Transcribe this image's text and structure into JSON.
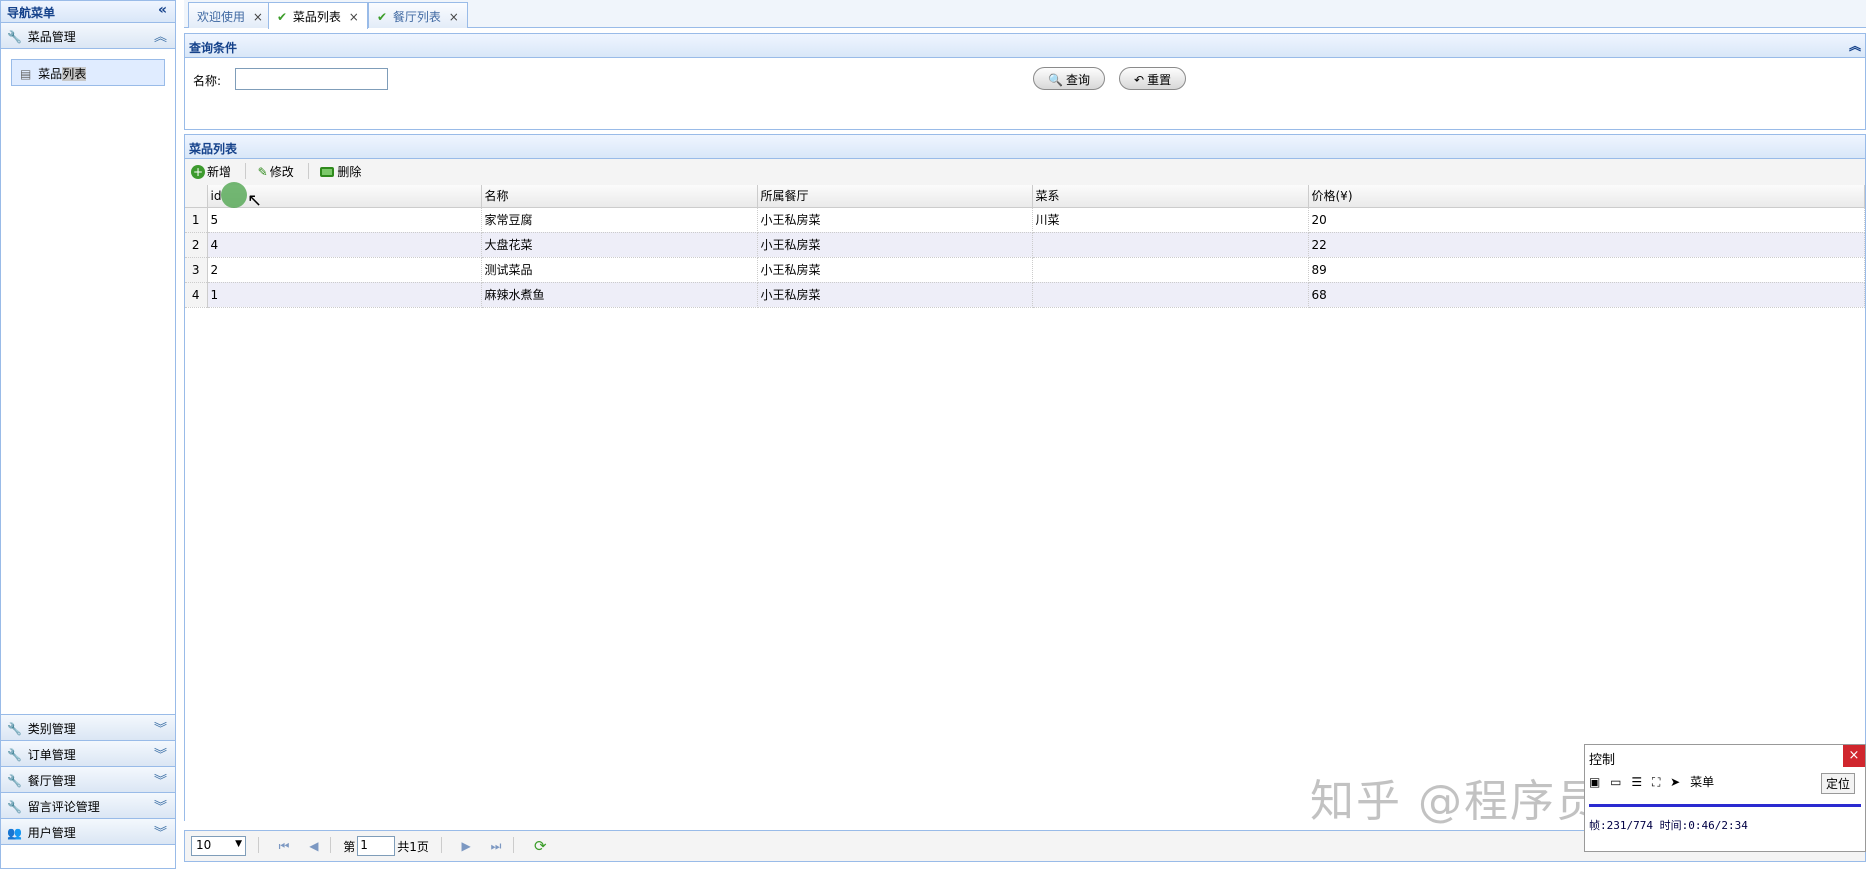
{
  "nav": {
    "title": "导航菜单",
    "sections": [
      {
        "label": "菜品管理",
        "items": [
          {
            "label_prefix": "菜品",
            "label_highlight": "列表"
          }
        ]
      }
    ],
    "collapsed_sections": [
      "类别管理",
      "订单管理",
      "餐厅管理",
      "留言评论管理",
      "用户管理"
    ]
  },
  "tabs": [
    {
      "label": "欢迎使用"
    },
    {
      "label": "菜品列表"
    },
    {
      "label": "餐厅列表"
    }
  ],
  "query": {
    "title": "查询条件",
    "name_label": "名称:",
    "name_value": "",
    "search_label": "查询",
    "reset_label": "重置"
  },
  "list": {
    "title": "菜品列表",
    "toolbar": {
      "add": "新增",
      "edit": "修改",
      "delete": "删除"
    },
    "columns": [
      "id",
      "名称",
      "所属餐厅",
      "菜系",
      "价格(¥)"
    ],
    "rows": [
      {
        "rn": "1",
        "id": "5",
        "name": "家常豆腐",
        "restaurant": "小王私房菜",
        "cuisine": "川菜",
        "price": "20"
      },
      {
        "rn": "2",
        "id": "4",
        "name": "大盘花菜",
        "restaurant": "小王私房菜",
        "cuisine": "",
        "price": "22"
      },
      {
        "rn": "3",
        "id": "2",
        "name": "测试菜品",
        "restaurant": "小王私房菜",
        "cuisine": "",
        "price": "89"
      },
      {
        "rn": "4",
        "id": "1",
        "name": "麻辣水煮鱼",
        "restaurant": "小王私房菜",
        "cuisine": "",
        "price": "68"
      }
    ]
  },
  "pager": {
    "page_size": "10",
    "page_prefix": "第",
    "page_value": "1",
    "total_text": "共1页"
  },
  "control": {
    "title": "控制",
    "close": "×",
    "menu_label": "菜单",
    "locate_label": "定位",
    "info": "帧:231/774 时间:0:46/2:34"
  },
  "watermark": "知乎 @程序员阿大爷"
}
